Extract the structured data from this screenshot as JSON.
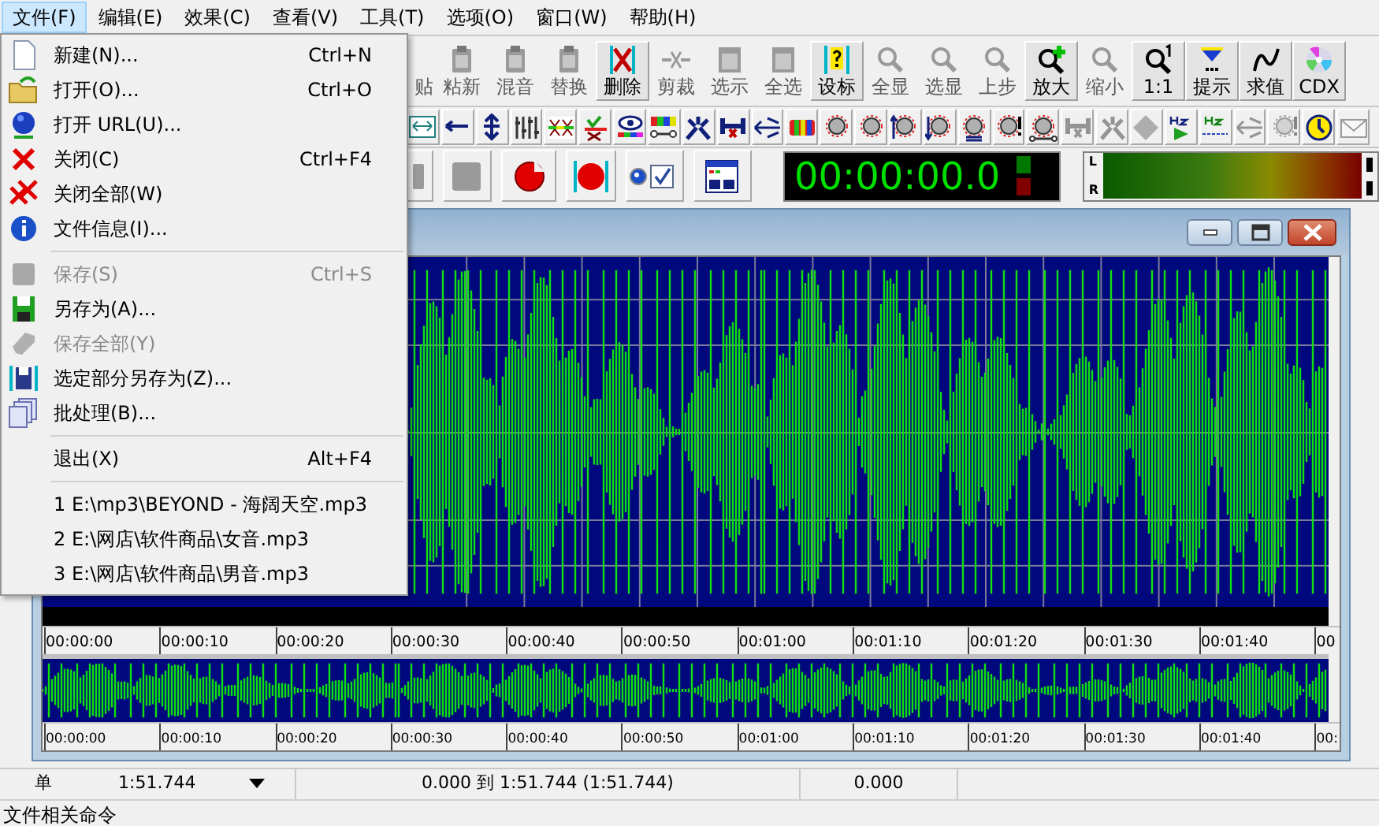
{
  "menu_bar": {
    "items": [
      {
        "label": "文件(F)",
        "selected": true
      },
      {
        "label": "编辑(E)",
        "selected": false
      },
      {
        "label": "效果(C)",
        "selected": false
      },
      {
        "label": "查看(V)",
        "selected": false
      },
      {
        "label": "工具(T)",
        "selected": false
      },
      {
        "label": "选项(O)",
        "selected": false
      },
      {
        "label": "窗口(W)",
        "selected": false
      },
      {
        "label": "帮助(H)",
        "selected": false
      }
    ]
  },
  "file_menu": {
    "items": [
      {
        "kind": "page",
        "label": "新建(N)...",
        "shortcut": "Ctrl+N",
        "disabled": false
      },
      {
        "kind": "folder",
        "label": "打开(O)...",
        "shortcut": "Ctrl+O",
        "disabled": false
      },
      {
        "kind": "globe",
        "label": "打开 URL(U)...",
        "disabled": false
      },
      {
        "kind": "cross",
        "label": "关闭(C)",
        "shortcut": "Ctrl+F4",
        "disabled": false
      },
      {
        "kind": "crosses",
        "label": "关闭全部(W)",
        "disabled": false
      },
      {
        "kind": "info",
        "label": "文件信息(I)...",
        "disabled": false
      },
      {
        "kind": "separator"
      },
      {
        "kind": "square",
        "label": "保存(S)",
        "shortcut": "Ctrl+S",
        "disabled": true
      },
      {
        "kind": "floppy",
        "label": "另存为(A)...",
        "disabled": false
      },
      {
        "kind": "blob",
        "label": "保存全部(Y)",
        "disabled": true
      },
      {
        "kind": "floppy-bars",
        "label": "选定部分另存为(Z)...",
        "disabled": false
      },
      {
        "kind": "pages",
        "label": "批处理(B)...",
        "disabled": false
      },
      {
        "kind": "separator"
      },
      {
        "kind": "plain",
        "label": "退出(X)",
        "shortcut": "Alt+F4",
        "disabled": false
      },
      {
        "kind": "separator"
      },
      {
        "kind": "plain",
        "label": "1 E:\\mp3\\BEYOND - 海阔天空.mp3",
        "disabled": false
      },
      {
        "kind": "plain",
        "label": "2 E:\\网店\\软件商品\\女音.mp3",
        "disabled": false
      },
      {
        "kind": "plain",
        "label": "3 E:\\网店\\软件商品\\男音.mp3",
        "disabled": false
      }
    ]
  },
  "main_toolbar": {
    "buttons": [
      {
        "label": "贴",
        "kind": "clipboard",
        "pressed": false,
        "disabled": true
      },
      {
        "label": "粘新",
        "kind": "clipboard",
        "pressed": false,
        "disabled": true
      },
      {
        "label": "混音",
        "kind": "clipboard",
        "pressed": false,
        "disabled": true
      },
      {
        "label": "替换",
        "kind": "clipboard",
        "pressed": false,
        "disabled": true
      },
      {
        "label": "删除",
        "kind": "delete",
        "pressed": true,
        "disabled": false
      },
      {
        "label": "剪裁",
        "kind": "trim",
        "pressed": false,
        "disabled": true
      },
      {
        "label": "选示",
        "kind": "window",
        "pressed": false,
        "disabled": true
      },
      {
        "label": "全选",
        "kind": "window",
        "pressed": false,
        "disabled": true
      },
      {
        "label": "设标",
        "kind": "marker",
        "pressed": true,
        "disabled": false
      },
      {
        "label": "全显",
        "kind": "zoom",
        "pressed": false,
        "disabled": true
      },
      {
        "label": "选显",
        "kind": "zoom",
        "pressed": false,
        "disabled": true
      },
      {
        "label": "上步",
        "kind": "zoom",
        "pressed": false,
        "disabled": true
      },
      {
        "label": "放大",
        "kind": "zoom-in",
        "pressed": true,
        "disabled": false
      },
      {
        "label": "缩小",
        "kind": "zoom",
        "pressed": false,
        "disabled": true
      },
      {
        "label": "1:1",
        "kind": "zoom-one",
        "pressed": true,
        "disabled": false
      },
      {
        "label": "提示",
        "kind": "hint",
        "pressed": true,
        "disabled": false
      },
      {
        "label": "求值",
        "kind": "function",
        "pressed": true,
        "disabled": false
      },
      {
        "label": "CDX",
        "kind": "disc",
        "pressed": true,
        "disabled": false
      }
    ]
  },
  "effects_toolbar": {
    "buttons": [
      {
        "kind": "fit",
        "disabled": false
      },
      {
        "kind": "arrow-left",
        "disabled": false
      },
      {
        "kind": "updown",
        "disabled": false
      },
      {
        "kind": "bars",
        "disabled": false
      },
      {
        "kind": "color-grid",
        "disabled": false
      },
      {
        "kind": "check-grid",
        "disabled": false
      },
      {
        "kind": "eye",
        "disabled": false
      },
      {
        "kind": "color-bars",
        "disabled": false
      },
      {
        "kind": "burst",
        "disabled": false
      },
      {
        "kind": "dumbbell",
        "disabled": false
      },
      {
        "kind": "arrow-lines",
        "disabled": false
      },
      {
        "kind": "capsule",
        "disabled": false
      },
      {
        "kind": "knob",
        "disabled": false
      },
      {
        "kind": "knob",
        "disabled": false
      },
      {
        "kind": "knob-up",
        "disabled": false
      },
      {
        "kind": "knob-down",
        "disabled": false
      },
      {
        "kind": "knob-bars",
        "disabled": false
      },
      {
        "kind": "knob-alert",
        "disabled": false
      },
      {
        "kind": "knob-line",
        "disabled": false
      },
      {
        "kind": "dumbbell",
        "disabled": true
      },
      {
        "kind": "burst",
        "disabled": true
      },
      {
        "kind": "diamond",
        "disabled": true
      },
      {
        "kind": "hz-play",
        "disabled": false
      },
      {
        "kind": "hz-line",
        "disabled": false
      },
      {
        "kind": "arrow-lines",
        "disabled": true
      },
      {
        "kind": "knob-alert",
        "disabled": true
      },
      {
        "kind": "clock",
        "disabled": false
      },
      {
        "kind": "envelope",
        "disabled": true
      }
    ]
  },
  "transport": {
    "time": "00:00:00.0",
    "meter_labels": [
      "L",
      "R"
    ]
  },
  "wave_window": {
    "ruler": [
      "00:00:00",
      "00:00:10",
      "00:00:20",
      "00:00:30",
      "00:00:40",
      "00:00:50",
      "00:01:00",
      "00:01:10",
      "00:01:20",
      "00:01:30",
      "00:01:40",
      "00"
    ],
    "overview_ruler": [
      "00:00:00",
      "00:00:10",
      "00:00:20",
      "00:00:30",
      "00:00:40",
      "00:00:50",
      "00:01:00",
      "00:01:10",
      "00:01:20",
      "00:01:30",
      "00:01:40",
      "00:"
    ]
  },
  "status_bar": {
    "cells": [
      "单",
      "1:51.744",
      "0.000 到 1:51.744 (1:51.744)",
      "0.000"
    ],
    "hint": "文件相关命令"
  }
}
